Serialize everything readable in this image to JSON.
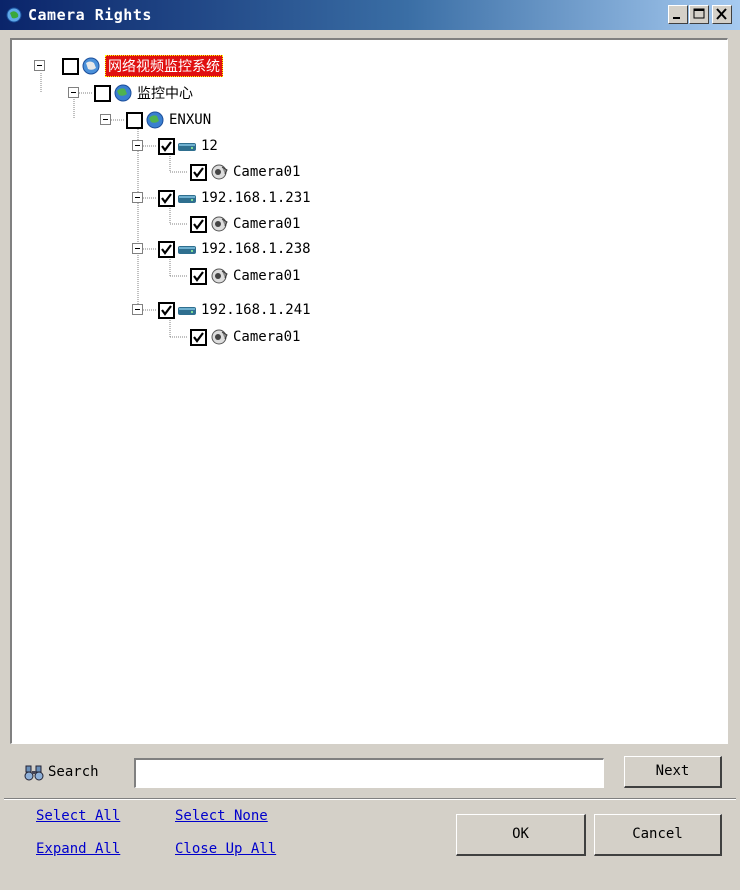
{
  "window": {
    "title": "Camera Rights",
    "controls": [
      "minimize",
      "maximize",
      "close"
    ]
  },
  "tree": {
    "root": {
      "label": "网络视频监控系统",
      "checked": false,
      "expanded": true,
      "icon": "globe-icon"
    },
    "center": {
      "label": "监控中心",
      "checked": false,
      "expanded": true,
      "icon": "globe-icon"
    },
    "site": {
      "label": "ENXUN",
      "checked": false,
      "expanded": true,
      "icon": "globe-icon"
    },
    "devices": [
      {
        "label": "12",
        "checked": true,
        "icon": "dvr-icon",
        "camera": {
          "label": "Camera01",
          "checked": true,
          "icon": "camera-icon"
        }
      },
      {
        "label": "192.168.1.231",
        "checked": true,
        "icon": "dvr-icon",
        "camera": {
          "label": "Camera01",
          "checked": true,
          "icon": "camera-icon"
        }
      },
      {
        "label": "192.168.1.238",
        "checked": true,
        "icon": "dvr-icon",
        "camera": {
          "label": "Camera01",
          "checked": true,
          "icon": "camera-icon"
        }
      },
      {
        "label": "192.168.1.241",
        "checked": true,
        "icon": "dvr-icon",
        "camera": {
          "label": "Camera01",
          "checked": true,
          "icon": "camera-icon"
        }
      }
    ]
  },
  "search": {
    "label": "Search",
    "value": "",
    "icon": "binoculars-icon",
    "next_label": "Next"
  },
  "links": {
    "select_all": "Select All",
    "select_none": "Select None",
    "expand_all": "Expand All",
    "close_up_all": "Close Up All"
  },
  "buttons": {
    "ok": "OK",
    "cancel": "Cancel"
  },
  "colors": {
    "title_start": "#0a246a",
    "title_end": "#a6caf0",
    "root_highlight": "#e01010",
    "link": "#0000cc",
    "face": "#d4d0c8"
  }
}
